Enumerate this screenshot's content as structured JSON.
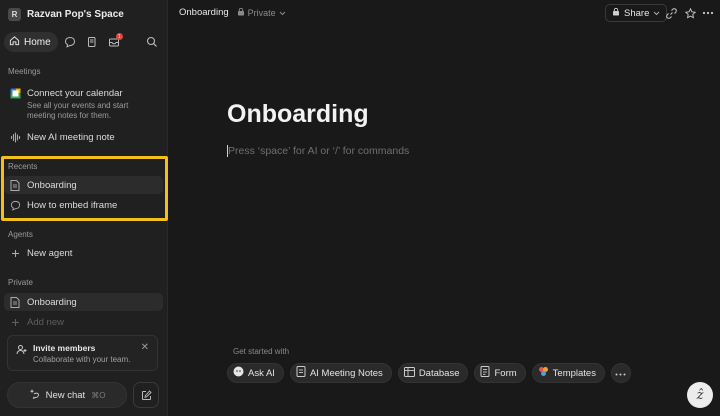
{
  "workspace": {
    "initial": "R",
    "name": "Razvan Pop's Space"
  },
  "nav": {
    "home_label": "Home",
    "inbox_badge": "1"
  },
  "meetings": {
    "label": "Meetings",
    "calendar_title": "Connect your calendar",
    "calendar_sub": "See all your events and start meeting notes for them.",
    "new_note": "New AI meeting note"
  },
  "recents": {
    "label": "Recents",
    "items": [
      {
        "label": "Onboarding",
        "icon": "page-icon"
      },
      {
        "label": "How to embed iframe",
        "icon": "chat-icon"
      }
    ]
  },
  "agents": {
    "label": "Agents",
    "new_agent": "New agent"
  },
  "private": {
    "label": "Private",
    "item": "Onboarding",
    "add_new": "Add new"
  },
  "invite": {
    "title": "Invite members",
    "sub": "Collaborate with your team."
  },
  "newchat": {
    "label": "New chat",
    "shortcut": "⌘O"
  },
  "header": {
    "title": "Onboarding",
    "visibility": "Private",
    "share": "Share"
  },
  "page": {
    "title": "Onboarding",
    "placeholder": "Press ‘space’ for AI or ‘/’ for commands"
  },
  "get_started": {
    "label": "Get started with",
    "chips": [
      "Ask AI",
      "AI Meeting Notes",
      "Database",
      "Form",
      "Templates"
    ]
  },
  "colors": {
    "highlight": "#f2c018",
    "badge": "#e0463a",
    "background": "#191919",
    "sidebar": "#202020"
  }
}
